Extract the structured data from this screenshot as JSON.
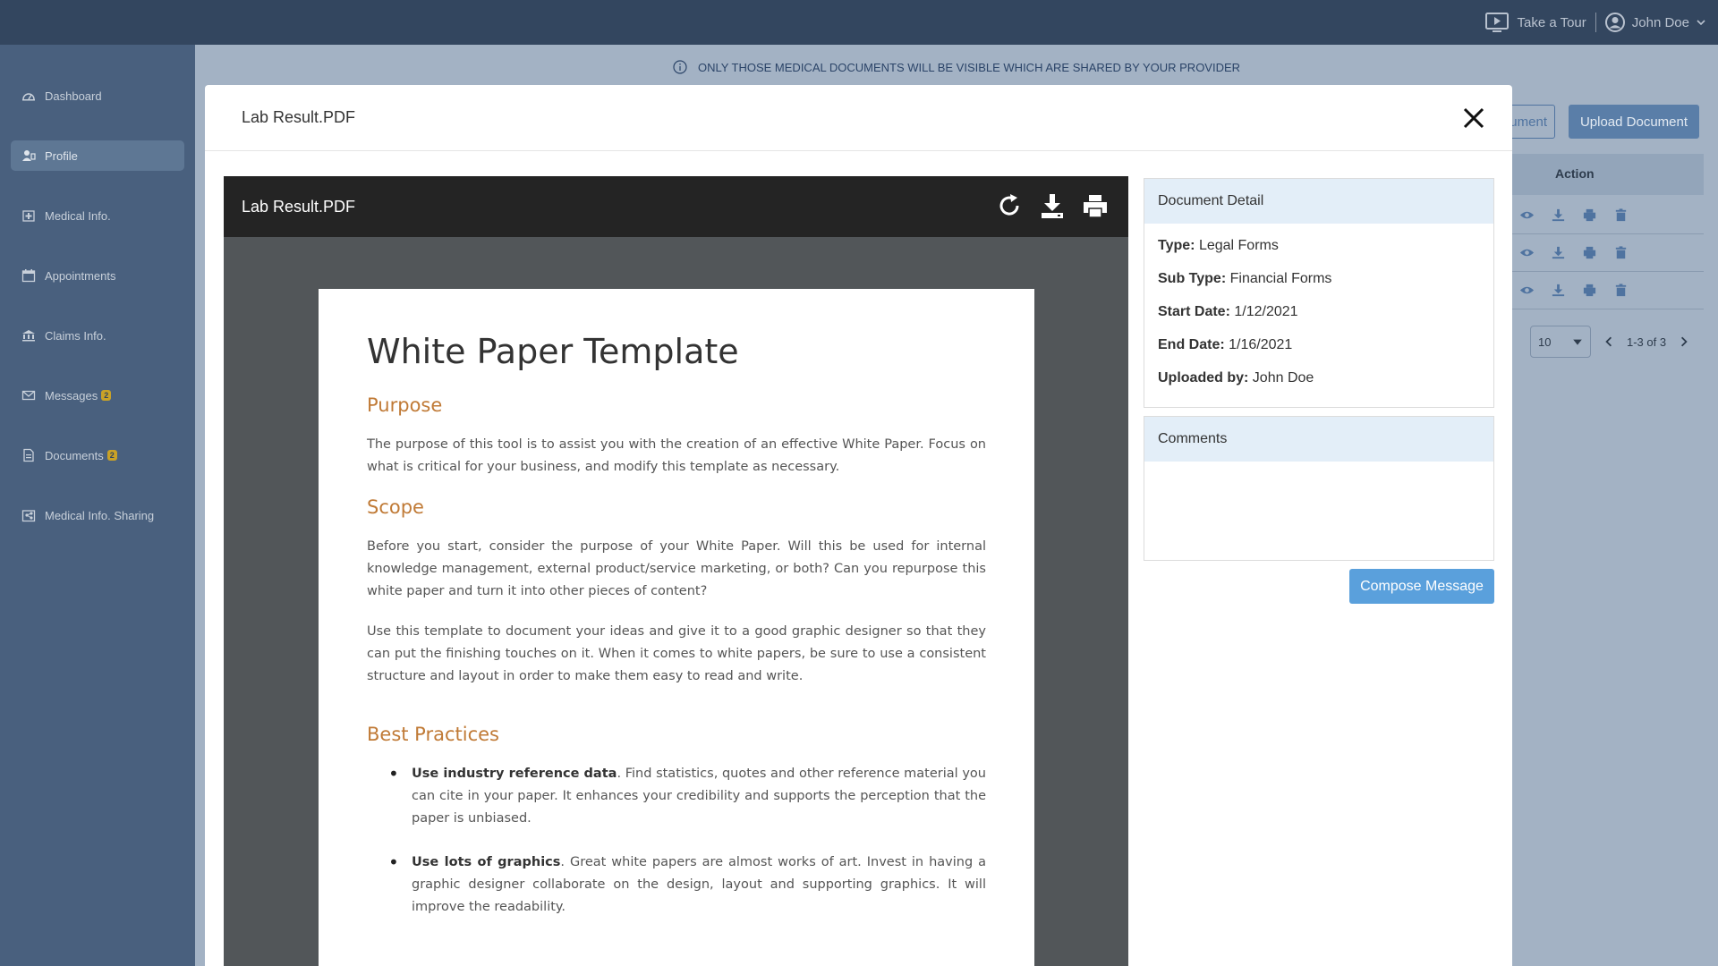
{
  "topbar": {
    "tour_label": "Take a Tour",
    "user_name": "John Doe"
  },
  "sidebar": {
    "items": [
      {
        "label": "Dashboard",
        "icon": "dashboard-icon"
      },
      {
        "label": "Profile",
        "icon": "profile-icon",
        "active": true
      },
      {
        "label": "Medical Info.",
        "icon": "medical-icon"
      },
      {
        "label": "Appointments",
        "icon": "calendar-icon"
      },
      {
        "label": "Claims Info.",
        "icon": "claims-icon"
      },
      {
        "label": "Messages",
        "icon": "messages-icon",
        "badge": "2"
      },
      {
        "label": "Documents",
        "icon": "documents-icon",
        "badge": "2"
      },
      {
        "label": "Medical Info. Sharing",
        "icon": "sharing-icon"
      }
    ]
  },
  "banner": {
    "text": "ONLY THOSE MEDICAL DOCUMENTS WILL BE VISIBLE WHICH ARE SHARED BY YOUR PROVIDER"
  },
  "background": {
    "outline_button": "ument",
    "upload_button": "Upload Document",
    "action_header": "Action",
    "page_size": "10",
    "pager_text": "1-3 of 3"
  },
  "modal": {
    "title": "Lab Result.PDF",
    "viewer": {
      "file_name": "Lab Result.PDF"
    },
    "pdf": {
      "title": "White Paper Template",
      "purpose_heading": "Purpose",
      "purpose_text": "The purpose of this tool is to assist you with the creation of an effective White Paper.  Focus on what is critical for your business, and modify this template as necessary.",
      "scope_heading": "Scope",
      "scope_text_1": "Before you start, consider the purpose of your White Paper.  Will this be used for internal knowledge management, external product/service marketing, or both? Can you repurpose this white paper and turn it into other pieces of content?",
      "scope_text_2": "Use this template to document your ideas and give it to a good graphic designer so that they can put the finishing touches on it. When it comes to white papers, be sure to use a consistent structure and layout in order to make them easy to read and write.",
      "best_heading": "Best Practices",
      "bullet_1_bold": "Use industry reference data",
      "bullet_1_text": ".  Find statistics, quotes and other reference material you can cite in your paper.  It enhances your credibility and supports the perception that the paper is unbiased.",
      "bullet_2_bold": "Use lots of graphics",
      "bullet_2_text": ".  Great white papers are almost works of art.  Invest in having a graphic designer collaborate on the design, layout and supporting graphics.  It will improve the readability."
    },
    "detail": {
      "heading": "Document Detail",
      "type_label": "Type:",
      "type_value": "Legal Forms",
      "subtype_label": "Sub Type:",
      "subtype_value": "Financial Forms",
      "start_label": "Start Date:",
      "start_value": "1/12/2021",
      "end_label": "End Date:",
      "end_value": "1/16/2021",
      "uploaded_label": "Uploaded by:",
      "uploaded_value": "John Doe"
    },
    "comments": {
      "heading": "Comments"
    },
    "compose_label": "Compose Message"
  },
  "colors": {
    "topbar": "#33465f",
    "sidebar": "#49607e",
    "accent_button": "#5aa0dc",
    "pdf_heading": "#c07a36",
    "card_header": "#e3eef8"
  }
}
